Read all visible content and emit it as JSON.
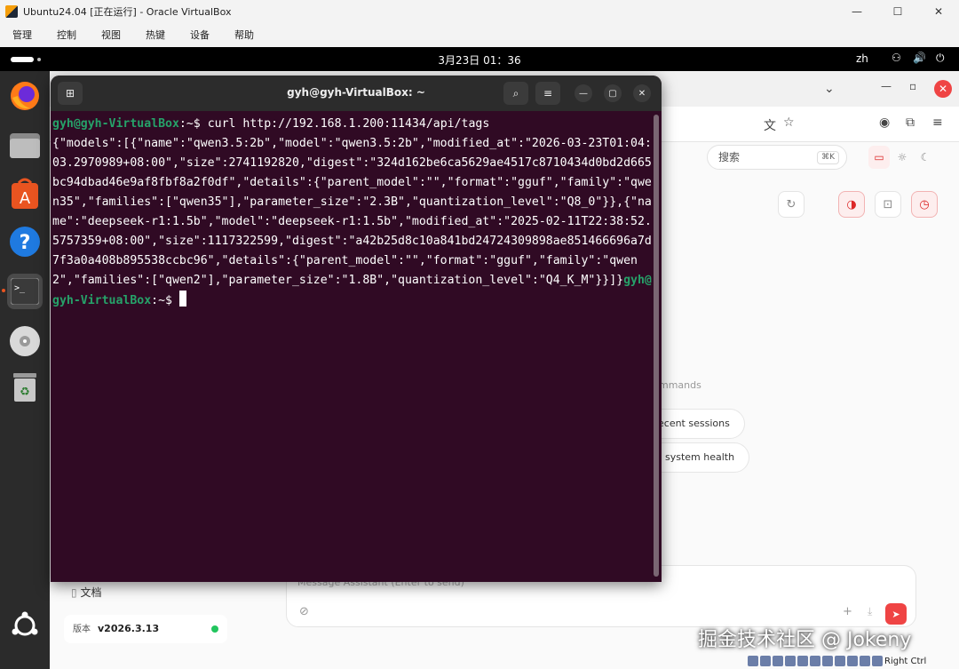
{
  "host_window": {
    "title": "Ubuntu24.04 [正在运行] - Oracle VirtualBox",
    "controls": [
      "—",
      "☐",
      "✕"
    ],
    "menus": [
      "管理",
      "控制",
      "视图",
      "热键",
      "设备",
      "帮助"
    ]
  },
  "gnome_bar": {
    "datetime": "3月23日  01：36",
    "input_lang": "zh"
  },
  "browser_app": {
    "search": {
      "placeholder": "搜索",
      "shortcut": "⌘K"
    },
    "commands_heading": "mmands",
    "suggestions": [
      "ecent sessions",
      "system health"
    ],
    "sidebar_docs": "文档",
    "version_label": "版本",
    "version_value": "v2026.3.13",
    "composer_placeholder": "Message Assistant (Enter to send)"
  },
  "terminal": {
    "title": "gyh@gyh-VirtualBox: ~",
    "prompt_user": "gyh@gyh-VirtualBox",
    "prompt_path": ":~$ ",
    "command": "curl http://192.168.1.200:11434/api/tags",
    "output": "{\"models\":[{\"name\":\"qwen3.5:2b\",\"model\":\"qwen3.5:2b\",\"modified_at\":\"2026-03-23T01:04:03.2970989+08:00\",\"size\":2741192820,\"digest\":\"324d162be6ca5629ae4517c8710434d0bd2d665bc94dbad46e9af8fbf8a2f0df\",\"details\":{\"parent_model\":\"\",\"format\":\"gguf\",\"family\":\"qwen35\",\"families\":[\"qwen35\"],\"parameter_size\":\"2.3B\",\"quantization_level\":\"Q8_0\"}},{\"name\":\"deepseek-r1:1.5b\",\"model\":\"deepseek-r1:1.5b\",\"modified_at\":\"2025-02-11T22:38:52.5757359+08:00\",\"size\":1117322599,\"digest\":\"a42b25d8c10a841bd24724309898ae851466696a7d7f3a0a408b895538ccbc96\",\"details\":{\"parent_model\":\"\",\"format\":\"gguf\",\"family\":\"qwen2\",\"families\":[\"qwen2\"],\"parameter_size\":\"1.8B\",\"quantization_level\":\"Q4_K_M\"}}]}",
    "prompt2_path": ":~$ "
  },
  "watermark": "掘金技术社区 @ Jokeny",
  "host_tray_label": "Right Ctrl",
  "colors": {
    "terminal_bg": "#300a24",
    "prompt_green": "#26a269",
    "path_blue": "#5c8cdb",
    "accent_red": "#ef4444"
  }
}
